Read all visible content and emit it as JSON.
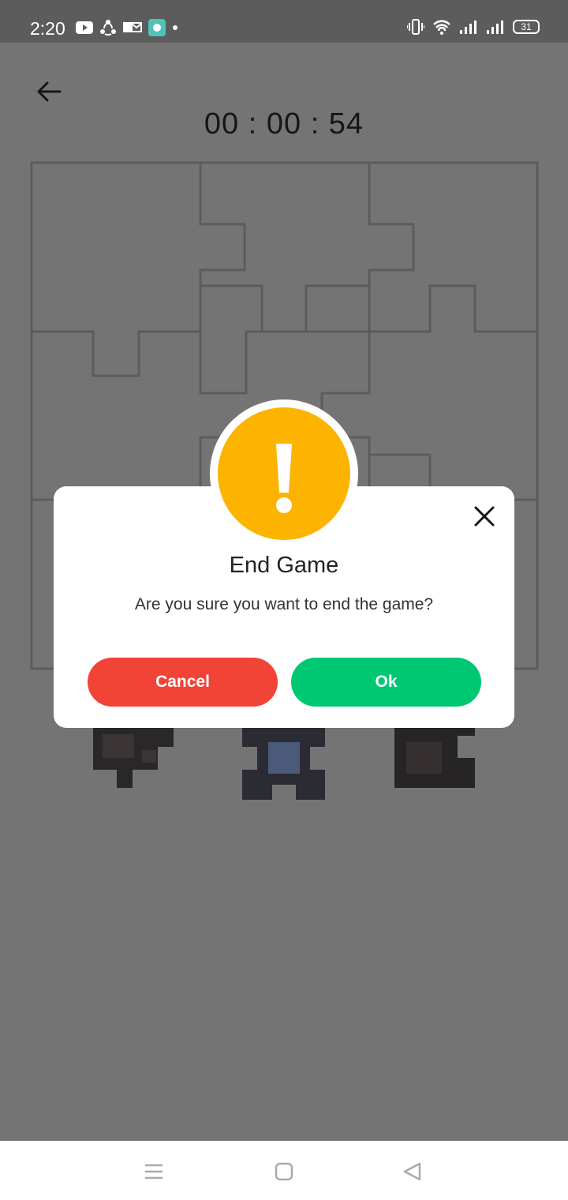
{
  "status_bar": {
    "time": "2:20",
    "battery": "31",
    "left_icons": [
      "youtube-icon",
      "share-icon",
      "outlook-icon",
      "chat-icon",
      "dot-icon"
    ],
    "right_icons": [
      "vibrate-icon",
      "wifi-icon",
      "signal-icon",
      "signal-icon",
      "battery-icon"
    ]
  },
  "game": {
    "timer": "00 : 00 : 54",
    "back_icon": "arrow-left-icon"
  },
  "dialog": {
    "title": "End Game",
    "message": "Are you sure you want to end the game?",
    "cancel_label": "Cancel",
    "ok_label": "Ok",
    "icon": "exclamation-icon",
    "close_icon": "close-icon"
  },
  "nav_bar": {
    "icons": [
      "menu-icon",
      "home-icon",
      "back-triangle-icon"
    ]
  },
  "colors": {
    "warning": "#FDB400",
    "cancel": "#F24337",
    "ok": "#00C872",
    "overlay": "#747474"
  }
}
